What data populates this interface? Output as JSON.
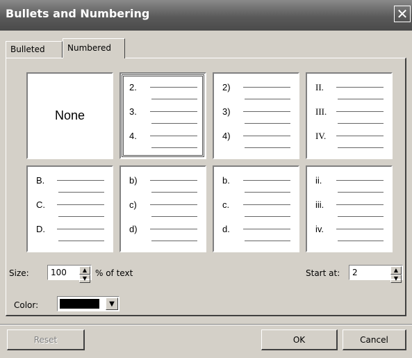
{
  "title": "Bullets and Numbering",
  "tabs": [
    {
      "label": "Bulleted",
      "active": false
    },
    {
      "label": "Numbered",
      "active": true
    }
  ],
  "styles": [
    {
      "kind": "none",
      "label": "None"
    },
    {
      "kind": "list",
      "markers": [
        "2.",
        "3.",
        "4."
      ],
      "selected": true,
      "roman": false
    },
    {
      "kind": "list",
      "markers": [
        "2)",
        "3)",
        "4)"
      ],
      "selected": false,
      "roman": false
    },
    {
      "kind": "list",
      "markers": [
        "II.",
        "III.",
        "IV."
      ],
      "selected": false,
      "roman": true
    },
    {
      "kind": "list",
      "markers": [
        "B.",
        "C.",
        "D."
      ],
      "selected": false,
      "roman": false
    },
    {
      "kind": "list",
      "markers": [
        "b)",
        "c)",
        "d)"
      ],
      "selected": false,
      "roman": false
    },
    {
      "kind": "list",
      "markers": [
        "b.",
        "c.",
        "d."
      ],
      "selected": false,
      "roman": false
    },
    {
      "kind": "list",
      "markers": [
        "ii.",
        "iii.",
        "iv."
      ],
      "selected": false,
      "roman": false
    }
  ],
  "size": {
    "label": "Size:",
    "value": "100",
    "suffix": "% of text"
  },
  "start": {
    "label": "Start at:",
    "value": "2"
  },
  "color": {
    "label": "Color:",
    "value": "#000000"
  },
  "buttons": {
    "reset": "Reset",
    "ok": "OK",
    "cancel": "Cancel"
  },
  "icons": {
    "close": "close-icon",
    "spin_up": "arrow-up-icon",
    "spin_down": "arrow-down-icon",
    "dropdown": "chevron-down-icon"
  }
}
